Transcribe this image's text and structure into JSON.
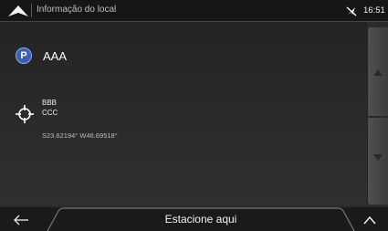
{
  "header": {
    "title": "Informação do local",
    "time": "16:51"
  },
  "place": {
    "name": "AAA",
    "parking_icon_letter": "P",
    "address_line1": "BBB",
    "address_line2": "CCC",
    "coordinates": "S23.62194° W46.69518°"
  },
  "bottom": {
    "main_action_label": "Estacione aqui"
  },
  "colors": {
    "parking_icon": "#3a5fb4",
    "background": "#2b2b2b"
  },
  "icons": [
    "home-arrow-icon",
    "gps-off-icon",
    "parking-icon",
    "crosshair-icon",
    "scroll-up-icon",
    "scroll-down-icon",
    "back-icon",
    "chevron-up-icon"
  ]
}
